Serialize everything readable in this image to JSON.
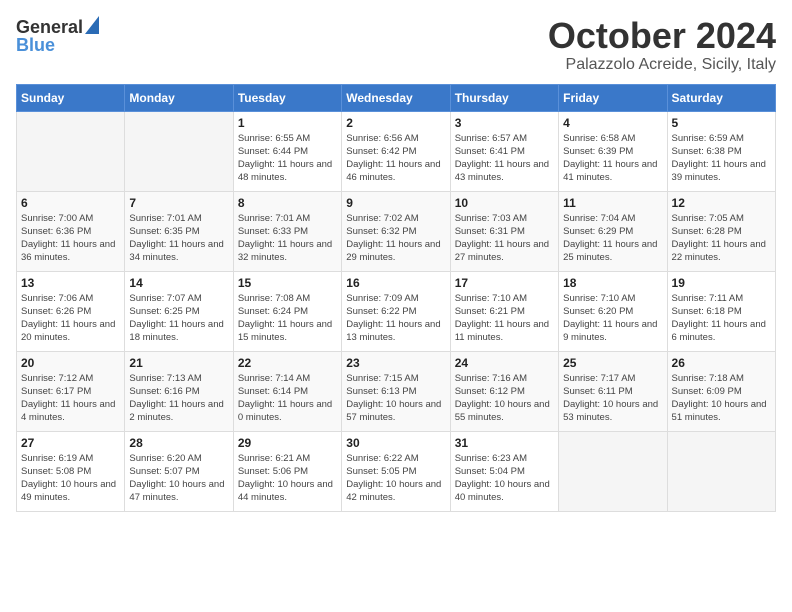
{
  "logo": {
    "general": "General",
    "blue": "Blue"
  },
  "title": "October 2024",
  "location": "Palazzolo Acreide, Sicily, Italy",
  "weekdays": [
    "Sunday",
    "Monday",
    "Tuesday",
    "Wednesday",
    "Thursday",
    "Friday",
    "Saturday"
  ],
  "weeks": [
    [
      {
        "day": "",
        "info": ""
      },
      {
        "day": "",
        "info": ""
      },
      {
        "day": "1",
        "info": "Sunrise: 6:55 AM\nSunset: 6:44 PM\nDaylight: 11 hours and 48 minutes."
      },
      {
        "day": "2",
        "info": "Sunrise: 6:56 AM\nSunset: 6:42 PM\nDaylight: 11 hours and 46 minutes."
      },
      {
        "day": "3",
        "info": "Sunrise: 6:57 AM\nSunset: 6:41 PM\nDaylight: 11 hours and 43 minutes."
      },
      {
        "day": "4",
        "info": "Sunrise: 6:58 AM\nSunset: 6:39 PM\nDaylight: 11 hours and 41 minutes."
      },
      {
        "day": "5",
        "info": "Sunrise: 6:59 AM\nSunset: 6:38 PM\nDaylight: 11 hours and 39 minutes."
      }
    ],
    [
      {
        "day": "6",
        "info": "Sunrise: 7:00 AM\nSunset: 6:36 PM\nDaylight: 11 hours and 36 minutes."
      },
      {
        "day": "7",
        "info": "Sunrise: 7:01 AM\nSunset: 6:35 PM\nDaylight: 11 hours and 34 minutes."
      },
      {
        "day": "8",
        "info": "Sunrise: 7:01 AM\nSunset: 6:33 PM\nDaylight: 11 hours and 32 minutes."
      },
      {
        "day": "9",
        "info": "Sunrise: 7:02 AM\nSunset: 6:32 PM\nDaylight: 11 hours and 29 minutes."
      },
      {
        "day": "10",
        "info": "Sunrise: 7:03 AM\nSunset: 6:31 PM\nDaylight: 11 hours and 27 minutes."
      },
      {
        "day": "11",
        "info": "Sunrise: 7:04 AM\nSunset: 6:29 PM\nDaylight: 11 hours and 25 minutes."
      },
      {
        "day": "12",
        "info": "Sunrise: 7:05 AM\nSunset: 6:28 PM\nDaylight: 11 hours and 22 minutes."
      }
    ],
    [
      {
        "day": "13",
        "info": "Sunrise: 7:06 AM\nSunset: 6:26 PM\nDaylight: 11 hours and 20 minutes."
      },
      {
        "day": "14",
        "info": "Sunrise: 7:07 AM\nSunset: 6:25 PM\nDaylight: 11 hours and 18 minutes."
      },
      {
        "day": "15",
        "info": "Sunrise: 7:08 AM\nSunset: 6:24 PM\nDaylight: 11 hours and 15 minutes."
      },
      {
        "day": "16",
        "info": "Sunrise: 7:09 AM\nSunset: 6:22 PM\nDaylight: 11 hours and 13 minutes."
      },
      {
        "day": "17",
        "info": "Sunrise: 7:10 AM\nSunset: 6:21 PM\nDaylight: 11 hours and 11 minutes."
      },
      {
        "day": "18",
        "info": "Sunrise: 7:10 AM\nSunset: 6:20 PM\nDaylight: 11 hours and 9 minutes."
      },
      {
        "day": "19",
        "info": "Sunrise: 7:11 AM\nSunset: 6:18 PM\nDaylight: 11 hours and 6 minutes."
      }
    ],
    [
      {
        "day": "20",
        "info": "Sunrise: 7:12 AM\nSunset: 6:17 PM\nDaylight: 11 hours and 4 minutes."
      },
      {
        "day": "21",
        "info": "Sunrise: 7:13 AM\nSunset: 6:16 PM\nDaylight: 11 hours and 2 minutes."
      },
      {
        "day": "22",
        "info": "Sunrise: 7:14 AM\nSunset: 6:14 PM\nDaylight: 11 hours and 0 minutes."
      },
      {
        "day": "23",
        "info": "Sunrise: 7:15 AM\nSunset: 6:13 PM\nDaylight: 10 hours and 57 minutes."
      },
      {
        "day": "24",
        "info": "Sunrise: 7:16 AM\nSunset: 6:12 PM\nDaylight: 10 hours and 55 minutes."
      },
      {
        "day": "25",
        "info": "Sunrise: 7:17 AM\nSunset: 6:11 PM\nDaylight: 10 hours and 53 minutes."
      },
      {
        "day": "26",
        "info": "Sunrise: 7:18 AM\nSunset: 6:09 PM\nDaylight: 10 hours and 51 minutes."
      }
    ],
    [
      {
        "day": "27",
        "info": "Sunrise: 6:19 AM\nSunset: 5:08 PM\nDaylight: 10 hours and 49 minutes."
      },
      {
        "day": "28",
        "info": "Sunrise: 6:20 AM\nSunset: 5:07 PM\nDaylight: 10 hours and 47 minutes."
      },
      {
        "day": "29",
        "info": "Sunrise: 6:21 AM\nSunset: 5:06 PM\nDaylight: 10 hours and 44 minutes."
      },
      {
        "day": "30",
        "info": "Sunrise: 6:22 AM\nSunset: 5:05 PM\nDaylight: 10 hours and 42 minutes."
      },
      {
        "day": "31",
        "info": "Sunrise: 6:23 AM\nSunset: 5:04 PM\nDaylight: 10 hours and 40 minutes."
      },
      {
        "day": "",
        "info": ""
      },
      {
        "day": "",
        "info": ""
      }
    ]
  ]
}
